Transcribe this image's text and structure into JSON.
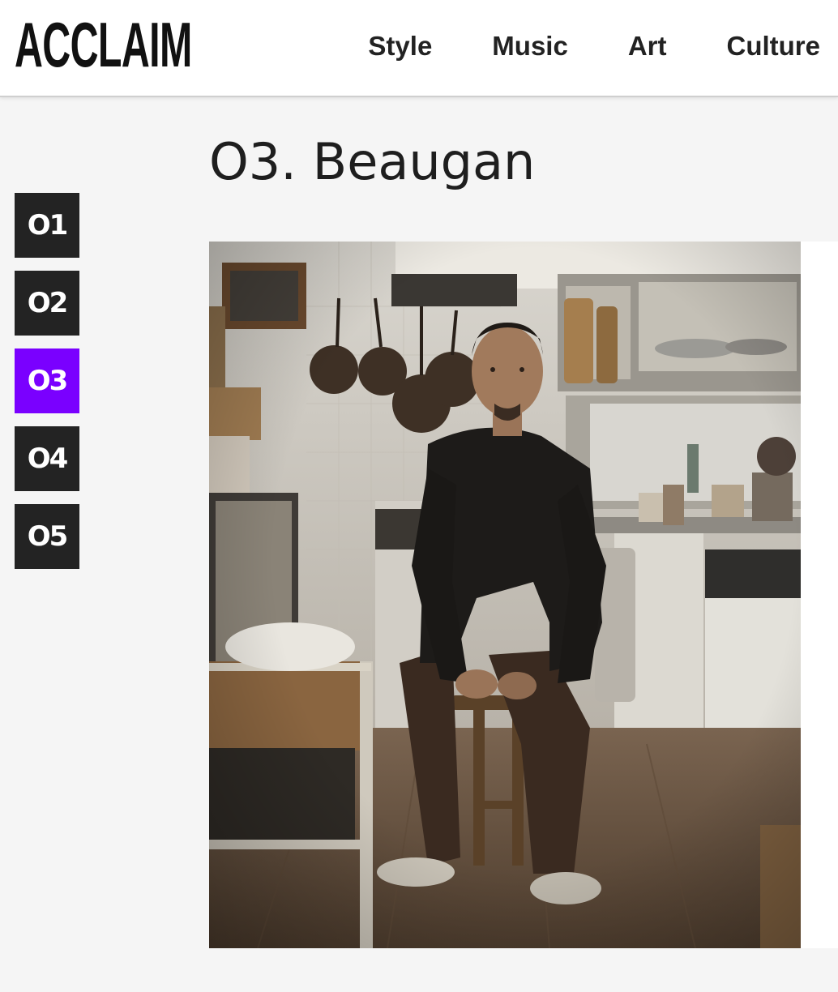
{
  "header": {
    "logo": "ACCLAIM",
    "nav": [
      {
        "label": "Style"
      },
      {
        "label": "Music"
      },
      {
        "label": "Art"
      },
      {
        "label": "Culture"
      }
    ]
  },
  "main": {
    "title": "O3. Beaugan"
  },
  "sidebar": {
    "items": [
      {
        "label": "O1"
      },
      {
        "label": "O2"
      },
      {
        "label": "O3"
      },
      {
        "label": "O4"
      },
      {
        "label": "O5"
      }
    ],
    "active_index": 2
  },
  "colors": {
    "accent": "#7a00ff",
    "tile": "#232323",
    "header_bg": "#ffffff",
    "page_bg": "#f5f5f5"
  }
}
